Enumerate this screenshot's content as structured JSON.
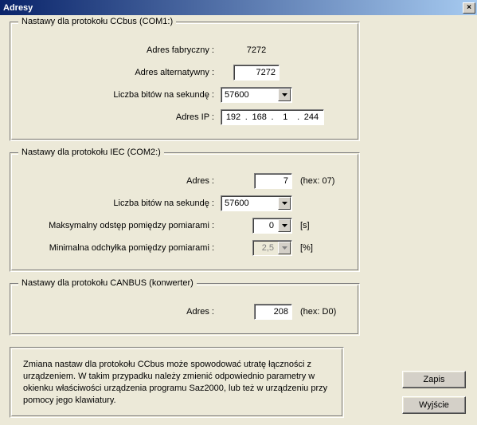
{
  "window": {
    "title": "Adresy",
    "close": "×"
  },
  "ccbus": {
    "legend": "Nastawy dla protokołu CCbus     (COM1:)",
    "factory_label": "Adres fabryczny :",
    "factory_value": "7272",
    "alt_label": "Adres alternatywny :",
    "alt_value": "7272",
    "baud_label": "Liczba bitów na sekundę :",
    "baud_value": "57600",
    "ip_label": "Adres IP :",
    "ip": {
      "o1": "192",
      "o2": "168",
      "o3": "1",
      "o4": "244"
    }
  },
  "iec": {
    "legend": "Nastawy dla protokołu IEC     (COM2:)",
    "addr_label": "Adres :",
    "addr_value": "7",
    "addr_hex": "(hex: 07)",
    "baud_label": "Liczba bitów na sekundę :",
    "baud_value": "57600",
    "max_gap_label": "Maksymalny odstęp pomiędzy pomiarami :",
    "max_gap_value": "0",
    "max_gap_unit": "[s]",
    "min_dev_label": "Minimalna odchyłka pomiędzy pomiarami :",
    "min_dev_value": "2,5",
    "min_dev_unit": "[%]"
  },
  "canbus": {
    "legend": "Nastawy dla protokołu CANBUS     (konwerter)",
    "addr_label": "Adres :",
    "addr_value": "208",
    "addr_hex": "(hex: D0)"
  },
  "warning": "Zmiana nastaw dla protokołu CCbus może spowodować utratę łączności z urządzeniem. W takim przypadku należy zmienić odpowiednio parametry w okienku właściwości urządzenia programu Saz2000, lub też w urządzeniu przy pomocy jego klawiatury.",
  "buttons": {
    "save": "Zapis",
    "exit": "Wyjście"
  }
}
